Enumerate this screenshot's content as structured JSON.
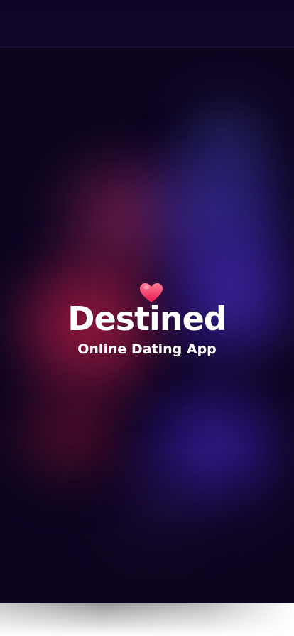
{
  "app": {
    "name": "Destined",
    "tagline": "Online Dating App"
  },
  "icons": {
    "logo": "heart-icon"
  },
  "colors": {
    "background": "#0d0520",
    "heart_top": "#ff6b8a",
    "heart_bottom": "#e8194f",
    "text": "#ffffff",
    "smoke_red": "#be1e46",
    "smoke_blue": "#5032d2"
  }
}
